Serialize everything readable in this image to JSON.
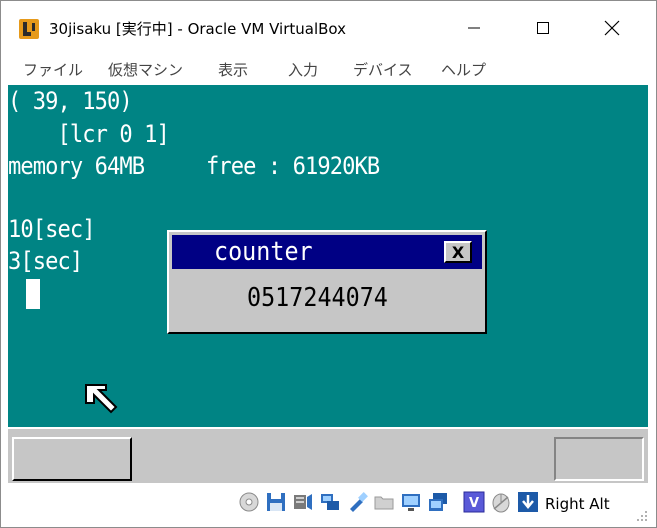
{
  "window": {
    "title": "30jisaku [実行中] - Oracle VM VirtualBox"
  },
  "menu": {
    "items": [
      "ファイル",
      "仮想マシン",
      "表示",
      "入力",
      "デバイス",
      "ヘルプ"
    ]
  },
  "guest": {
    "lines": [
      "( 39, 150)",
      "    [lcr 0 1]",
      "memory 64MB     free : 61920KB",
      "",
      "10[sec]",
      "3[sec]"
    ],
    "counter_window": {
      "title": "counter",
      "close_label": "X",
      "value": "0517244074"
    },
    "colors": {
      "desktop": "#008484",
      "taskbar": "#c6c6c6",
      "titlebar_active": "#000084"
    }
  },
  "statusbar": {
    "icons": [
      "optical-disk-icon",
      "floppy-icon",
      "audio-icon",
      "network-icon",
      "usb-icon",
      "shared-folder-icon",
      "display-icon",
      "recording-icon",
      "virtualization-icon",
      "mouse-integration-icon",
      "keyboard-capture-icon"
    ],
    "host_key": "Right Alt"
  }
}
